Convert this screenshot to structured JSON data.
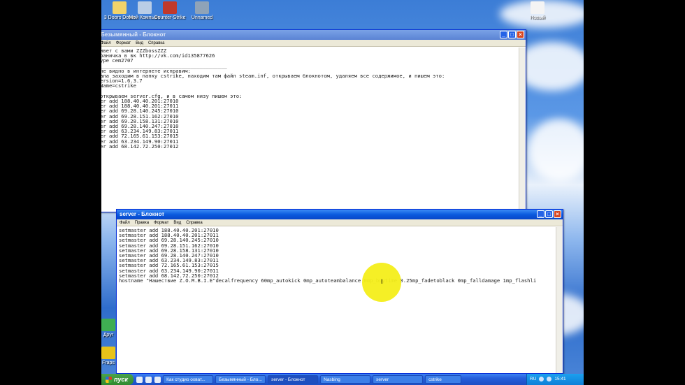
{
  "desktop": {
    "icons": [
      {
        "label": "3 Doors Down"
      },
      {
        "label": "Moй Компьют."
      },
      {
        "label": "Counter-Strike"
      },
      {
        "label": "Unnamed"
      },
      {
        "label": "Новый"
      },
      {
        "label": "Друг"
      },
      {
        "label": "Fraps"
      }
    ]
  },
  "window_back": {
    "title": "Безымянный - Блокнот",
    "menu": [
      "Файл",
      "Формат",
      "Вид",
      "Справка"
    ],
    "lines": [
      "ивет с вами ZZZbossZZZ",
      "раничка в вк http://vk.com/id135877626",
      "ype cem2707",
      "__________________________________________",
      "не видно в интернете исправим:",
      "ала заходим в папку cstrike, находим там файл steam.inf, открываем блокнотом, удаляем все содержимое, и пишем это:",
      "ersion=1.6.3.7",
      "Name=cstrike",
      "",
      "открываем server.cfg, и в самом низу пишем это:",
      "er add 188.40.40.201:27010",
      "er add 188.40.40.201:27011",
      "er add 69.28.140.245:27010",
      "er add 69.28.151.162:27010",
      "er add 69.28.158.131:27010",
      "er add 69.28.140.247:27010",
      "er add 63.234.149.83:27011",
      "er add 72.165.61.153:27015",
      "er add 63.234.149.90:27011",
      "er add 68.142.72.250:27012"
    ]
  },
  "window_front": {
    "title": "server - Блокнот",
    "menu": [
      "Файл",
      "Правка",
      "Формат",
      "Вид",
      "Справка"
    ],
    "lines": [
      "setmaster add 188.40.40.201:27010",
      "setmaster add 188.40.40.201:27011",
      "setmaster add 69.28.140.245:27010",
      "setmaster add 69.28.151.162:27010",
      "setmaster add 69.28.158.131:27010",
      "setmaster add 69.28.140.247:27010",
      "setmaster add 63.234.149.83:27011",
      "setmaster add 72.165.61.153:27015",
      "setmaster add 63.234.149.90:27011",
      "setmaster add 68.142.72.250:27012",
      "hostname \"Нашествие Z.O.M.B.I.E\"decalfrequency 60mp_autokick 0mp_autoteambalance 0mp_buytime 0.25mp_fadetoblack 0mp_falldamage 1mp_flashli"
    ]
  },
  "taskbar": {
    "start_label": "пуск",
    "tasks": [
      {
        "label": "Как студио охват..."
      },
      {
        "label": "Безымянный - Бло..."
      },
      {
        "label": "server - Блокнот"
      },
      {
        "label": "Nasbing"
      },
      {
        "label": "server"
      },
      {
        "label": "cstrike"
      }
    ],
    "tray": {
      "lang": "RU",
      "time": "15:41"
    }
  }
}
